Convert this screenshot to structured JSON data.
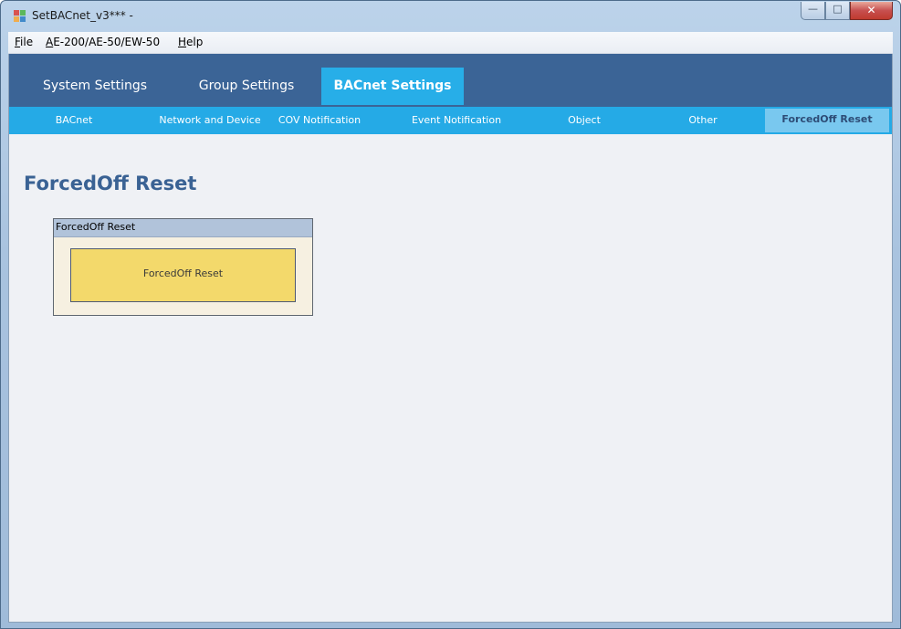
{
  "window": {
    "title": "SetBACnet_v3*** -",
    "controls": {
      "minimize_icon": "minimize-icon",
      "maximize_icon": "maximize-icon",
      "close_icon": "close-icon"
    }
  },
  "menu": {
    "items": [
      {
        "label": "File",
        "underline": "F"
      },
      {
        "label": "AE-200/AE-50/EW-50",
        "underline": "A"
      },
      {
        "label": "Help",
        "underline": "H"
      }
    ]
  },
  "main_tabs": [
    {
      "label": "System Settings",
      "active": false
    },
    {
      "label": "Group Settings",
      "active": false
    },
    {
      "label": "BACnet Settings",
      "active": true
    }
  ],
  "sub_tabs": [
    {
      "label": "BACnet",
      "active": false
    },
    {
      "label": "Network and Device",
      "active": false
    },
    {
      "label": "COV Notification",
      "active": false
    },
    {
      "label": "Event Notification",
      "active": false
    },
    {
      "label": "Object",
      "active": false
    },
    {
      "label": "Other",
      "active": false
    },
    {
      "label": "ForcedOff Reset",
      "active": true
    }
  ],
  "page": {
    "title": "ForcedOff Reset",
    "group": {
      "header": "ForcedOff Reset",
      "button_label": "ForcedOff Reset"
    }
  },
  "colors": {
    "main_tab_bar": "#3b6496",
    "active_main_tab": "#27aee8",
    "sub_tab_bar": "#25aae6",
    "active_sub_tab": "#79c8ef",
    "page_title": "#3a6294",
    "button_fill": "#f3d96b",
    "group_fill": "#f6f0e1"
  }
}
